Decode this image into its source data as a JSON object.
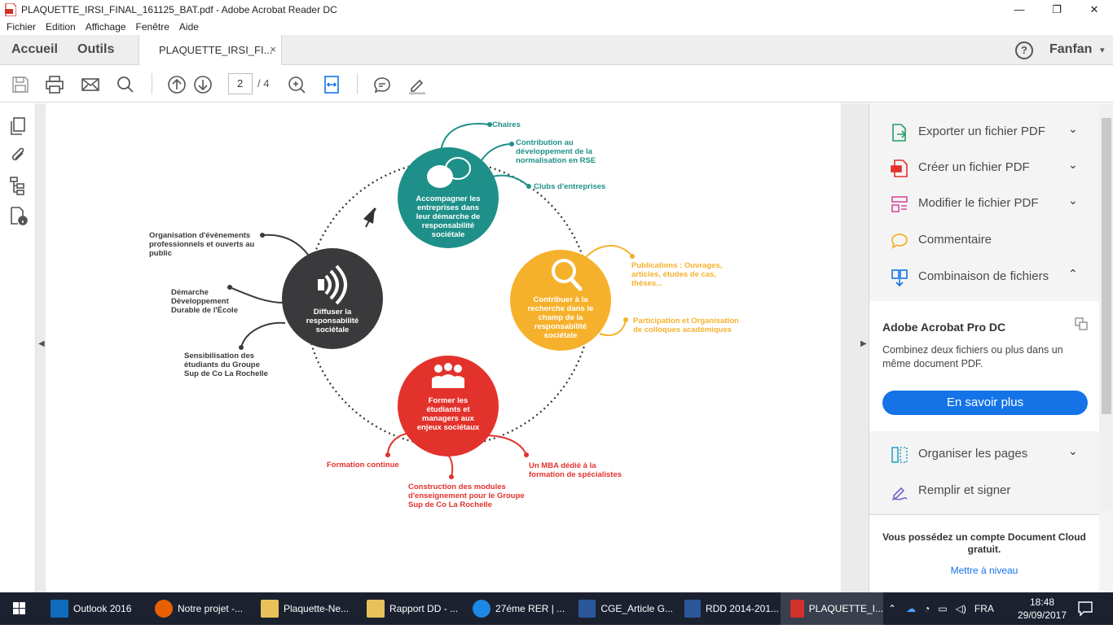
{
  "window": {
    "title": "PLAQUETTE_IRSI_FINAL_161125_BAT.pdf - Adobe Acrobat Reader DC",
    "controls": [
      "—",
      "❐",
      "✕"
    ]
  },
  "menu": [
    "Fichier",
    "Edition",
    "Affichage",
    "Fenêtre",
    "Aide"
  ],
  "tabs": {
    "home": "Accueil",
    "tools": "Outils",
    "document": "PLAQUETTE_IRSI_FI...",
    "close": "×",
    "help": "?",
    "user": "Fanfan",
    "user_caret": "▾"
  },
  "toolbar": {
    "page_current": "2",
    "page_total": "/ 4"
  },
  "diagram": {
    "teal_circle": "Accompagner les entreprises dans leur démarche de responsabilité sociétale",
    "teal_items": [
      "Chaires",
      "Contribution au développement de la normalisation en RSE",
      "Clubs d'entreprises"
    ],
    "orange_circle": "Contribuer à la recherche dans le champ de la responsabilité sociétale",
    "orange_items": [
      "Publications : Ouvrages, articles, études de cas, thèses...",
      "Participation et Organisation de colloques académiques"
    ],
    "red_circle": "Former les étudiants et managers aux enjeux sociétaux",
    "red_items": [
      "Formation continue",
      "Construction des modules d'enseignement pour le Groupe Sup de Co La Rochelle",
      "Un MBA dédié à la formation de spécialistes"
    ],
    "dark_circle": "Diffuser la responsabilité sociétale",
    "dark_items": [
      "Organisation d'évènements professionnels et ouverts au public",
      "Démarche Développement Durable de l'École",
      "Sensibilisation des étudiants du Groupe Sup de Co La Rochelle"
    ]
  },
  "right_panel": {
    "items": [
      {
        "label": "Exporter un fichier PDF",
        "chevron": "⌄"
      },
      {
        "label": "Créer un fichier PDF",
        "chevron": "⌄"
      },
      {
        "label": "Modifier le fichier PDF",
        "chevron": "⌄"
      },
      {
        "label": "Commentaire",
        "chevron": ""
      },
      {
        "label": "Combinaison de fichiers",
        "chevron": "⌃"
      }
    ],
    "promo_title": "Adobe Acrobat Pro DC",
    "promo_desc": "Combinez deux fichiers ou plus dans un même document PDF.",
    "promo_button": "En savoir plus",
    "items_after": [
      {
        "label": "Organiser les pages",
        "chevron": "⌄"
      },
      {
        "label": "Remplir et signer",
        "chevron": ""
      }
    ],
    "cloud_text": "Vous possédez un compte Document Cloud gratuit.",
    "cloud_link": "Mettre à niveau"
  },
  "taskbar": {
    "apps": [
      "Outlook 2016",
      "Notre projet -...",
      "Plaquette-Ne...",
      "Rapport DD - ...",
      "27éme RER | ...",
      "CGE_Article G...",
      "RDD 2014-201...",
      "PLAQUETTE_I..."
    ],
    "language": "FRA",
    "time": "18:48",
    "date": "29/09/2017",
    "notifications": "1"
  },
  "colors": {
    "teal": "#1e9089",
    "orange": "#f6b12c",
    "red": "#e3322c",
    "dark": "#3a3a3c",
    "adobe_blue": "#1473e6",
    "taskbar": "#1c2130"
  }
}
